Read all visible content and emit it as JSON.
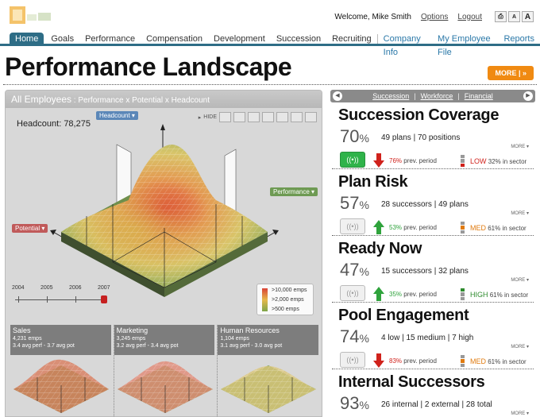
{
  "header": {
    "welcome": "Welcome, Mike Smith",
    "options": "Options",
    "logout": "Logout",
    "tools": [
      "⎙",
      "A",
      "A"
    ]
  },
  "nav": {
    "items": [
      "Home",
      "Goals",
      "Performance",
      "Compensation",
      "Development",
      "Succession",
      "Recruiting"
    ],
    "links": [
      "Company Info",
      "My Employee File",
      "Reports"
    ]
  },
  "page": {
    "title": "Performance Landscape",
    "more": "MORE | »"
  },
  "viz": {
    "title": "All Employees",
    "subtitle": " : Performance x Potential x Headcount",
    "hide": "HIDE",
    "headcount": "Headcount: 78,275",
    "axis_headcount": "Headcount ▾",
    "axis_performance": "Performance ▾",
    "axis_potential": "Potential ▾",
    "years": [
      "2004",
      "2005",
      "2006",
      "2007"
    ],
    "legend": [
      ">10,000 emps",
      ">2,000 emps",
      ">500 emps"
    ],
    "thumbs": [
      {
        "name": "Sales",
        "emps": "4,231 emps",
        "avg": "3.4 avg perf - 3.7 avg pot"
      },
      {
        "name": "Marketing",
        "emps": "3,245 emps",
        "avg": "3.2 avg perf - 3.4 avg pot"
      },
      {
        "name": "Human Resources",
        "emps": "1,104 emps",
        "avg": "3.1 avg perf - 3.0 avg pot"
      }
    ]
  },
  "right": {
    "tabs": [
      "Succession",
      "Workforce",
      "Financial"
    ],
    "more": "MORE ▾",
    "metrics": [
      {
        "name": "Succession Coverage",
        "pct": "70",
        "detail": "49 plans | 70 positions",
        "trend": "down",
        "trend_val": "76%",
        "trend_label": " prev. period",
        "level": "LOW",
        "sector": " 32% in sector",
        "signal_on": true
      },
      {
        "name": "Plan Risk",
        "pct": "57",
        "detail": "28 successors | 49 plans",
        "trend": "up",
        "trend_val": "53%",
        "trend_label": " prev. period",
        "level": "MED",
        "sector": " 61% in sector",
        "signal_on": false
      },
      {
        "name": "Ready Now",
        "pct": "47",
        "detail": "15 successors | 32 plans",
        "trend": "up",
        "trend_val": "35%",
        "trend_label": " prev. period",
        "level": "HIGH",
        "sector": " 61% in sector",
        "signal_on": false
      },
      {
        "name": "Pool Engagement",
        "pct": "74",
        "detail": "4 low | 15 medium | 7 high",
        "trend": "down",
        "trend_val": "83%",
        "trend_label": " prev. period",
        "level": "MED",
        "sector": " 61% in sector",
        "signal_on": false
      },
      {
        "name": "Internal Successors",
        "pct": "93",
        "detail": "26 internal | 2 external | 28 total",
        "trend": "up",
        "trend_val": "",
        "trend_label": "",
        "level": "",
        "sector": "",
        "signal_on": false
      }
    ]
  },
  "colors": {
    "nav": "#2e6d86",
    "accent": "#f08a12",
    "down": "#d0221c",
    "up": "#2fa33c",
    "low": "#d0221c",
    "med": "#e07b10",
    "high": "#2e8b2e"
  }
}
